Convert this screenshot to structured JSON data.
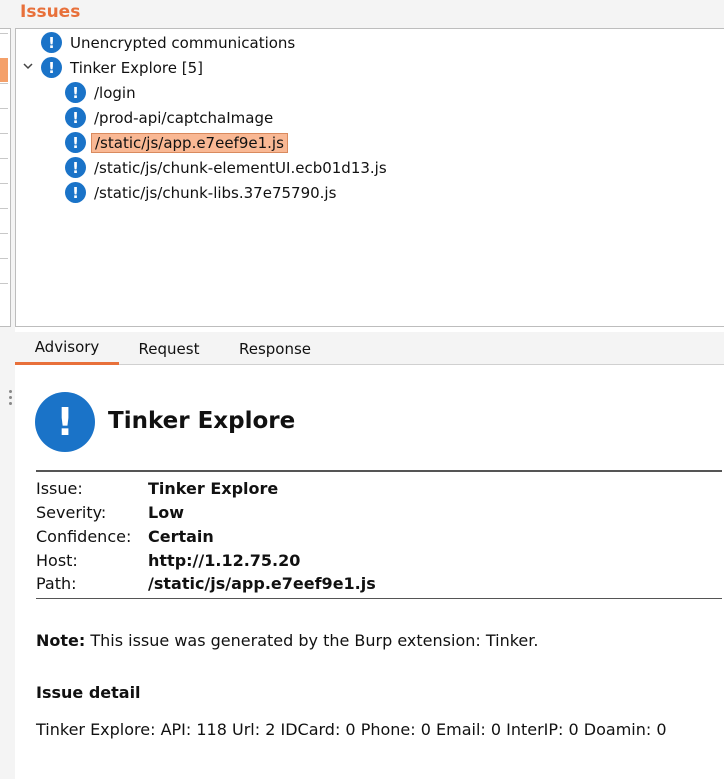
{
  "header": {
    "title": "Issues"
  },
  "tree": {
    "items": [
      {
        "label": "Unencrypted communications",
        "icon": "info-exclamation-icon",
        "level": 0
      },
      {
        "label": "Tinker Explore [5]",
        "icon": "info-exclamation-icon",
        "level": 0,
        "expanded": true
      },
      {
        "label": "/login",
        "icon": "info-exclamation-icon",
        "level": 1
      },
      {
        "label": "/prod-api/captchaImage",
        "icon": "info-exclamation-icon",
        "level": 1
      },
      {
        "label": "/static/js/app.e7eef9e1.js",
        "icon": "info-exclamation-icon",
        "level": 1,
        "selected": true
      },
      {
        "label": "/static/js/chunk-elementUI.ecb01d13.js",
        "icon": "info-exclamation-icon",
        "level": 1
      },
      {
        "label": "/static/js/chunk-libs.37e75790.js",
        "icon": "info-exclamation-icon",
        "level": 1
      }
    ]
  },
  "tabs": [
    {
      "label": "Advisory",
      "active": true
    },
    {
      "label": "Request",
      "active": false
    },
    {
      "label": "Response",
      "active": false
    }
  ],
  "advisory": {
    "icon_glyph": "!",
    "title": "Tinker Explore",
    "fields": [
      {
        "label": "Issue:",
        "value": "Tinker Explore"
      },
      {
        "label": "Severity:",
        "value": "Low"
      },
      {
        "label": "Confidence:",
        "value": "Certain"
      },
      {
        "label": "Host:",
        "value": "http://1.12.75.20"
      },
      {
        "label": "Path:",
        "value": "/static/js/app.e7eef9e1.js"
      }
    ],
    "note_label": "Note:",
    "note_text": " This issue was generated by the Burp extension: Tinker.",
    "detail_heading": "Issue detail",
    "detail_text": "Tinker Explore: API: 118 Url: 2 IDCard: 0 Phone: 0 Email: 0 InterIP: 0 Doamin: 0"
  },
  "colors": {
    "accent": "#e8703a",
    "icon_blue": "#1a73c8",
    "selection": "#f9b894"
  }
}
